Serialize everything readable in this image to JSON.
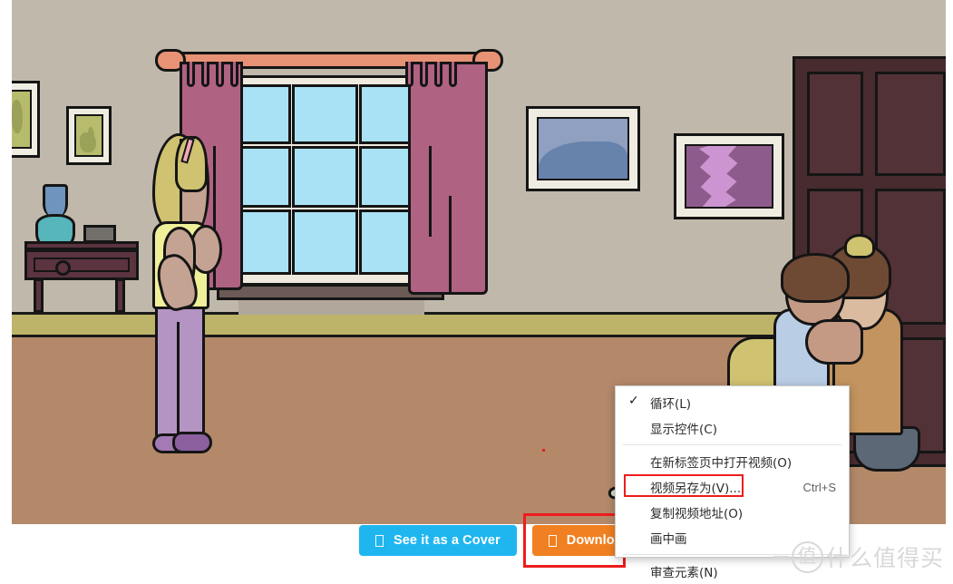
{
  "page": {
    "loading_bar_color": "#3dcc79"
  },
  "scene": {
    "name": "living-room-illustration",
    "wall_color": "#c0b8ab",
    "baseboard_color": "#bdb369",
    "floor_color": "#b3896a",
    "curtain_color": "#b06282",
    "rod_color": "#e79274",
    "window_pane_color": "#aae2f5",
    "door_color": "#472b2f"
  },
  "buttons": {
    "cover": {
      "label": "See it as a Cover",
      "icon": "tofu-glyph-icon",
      "color": "#1fb6ef"
    },
    "download": {
      "label": "Download",
      "icon": "tofu-glyph-icon",
      "color": "#f08021",
      "highlight_color": "#ee1c1c"
    }
  },
  "context_menu": {
    "items": [
      {
        "label": "循环(L)",
        "checked": true,
        "accel": ""
      },
      {
        "label": "显示控件(C)",
        "checked": false,
        "accel": ""
      },
      {
        "label": "在新标签页中打开视频(O)",
        "checked": false,
        "accel": ""
      },
      {
        "label": "视频另存为(V)...",
        "checked": false,
        "accel": "Ctrl+S",
        "highlighted": true
      },
      {
        "label": "复制视频地址(O)",
        "checked": false,
        "accel": ""
      },
      {
        "label": "画中画",
        "checked": false,
        "accel": ""
      },
      {
        "label": "审查元素(N)",
        "checked": false,
        "accel": ""
      }
    ],
    "check_glyph": "✓",
    "highlight_color": "#ee1c1c"
  },
  "watermark": {
    "badge": "值",
    "text": "什么值得买"
  }
}
